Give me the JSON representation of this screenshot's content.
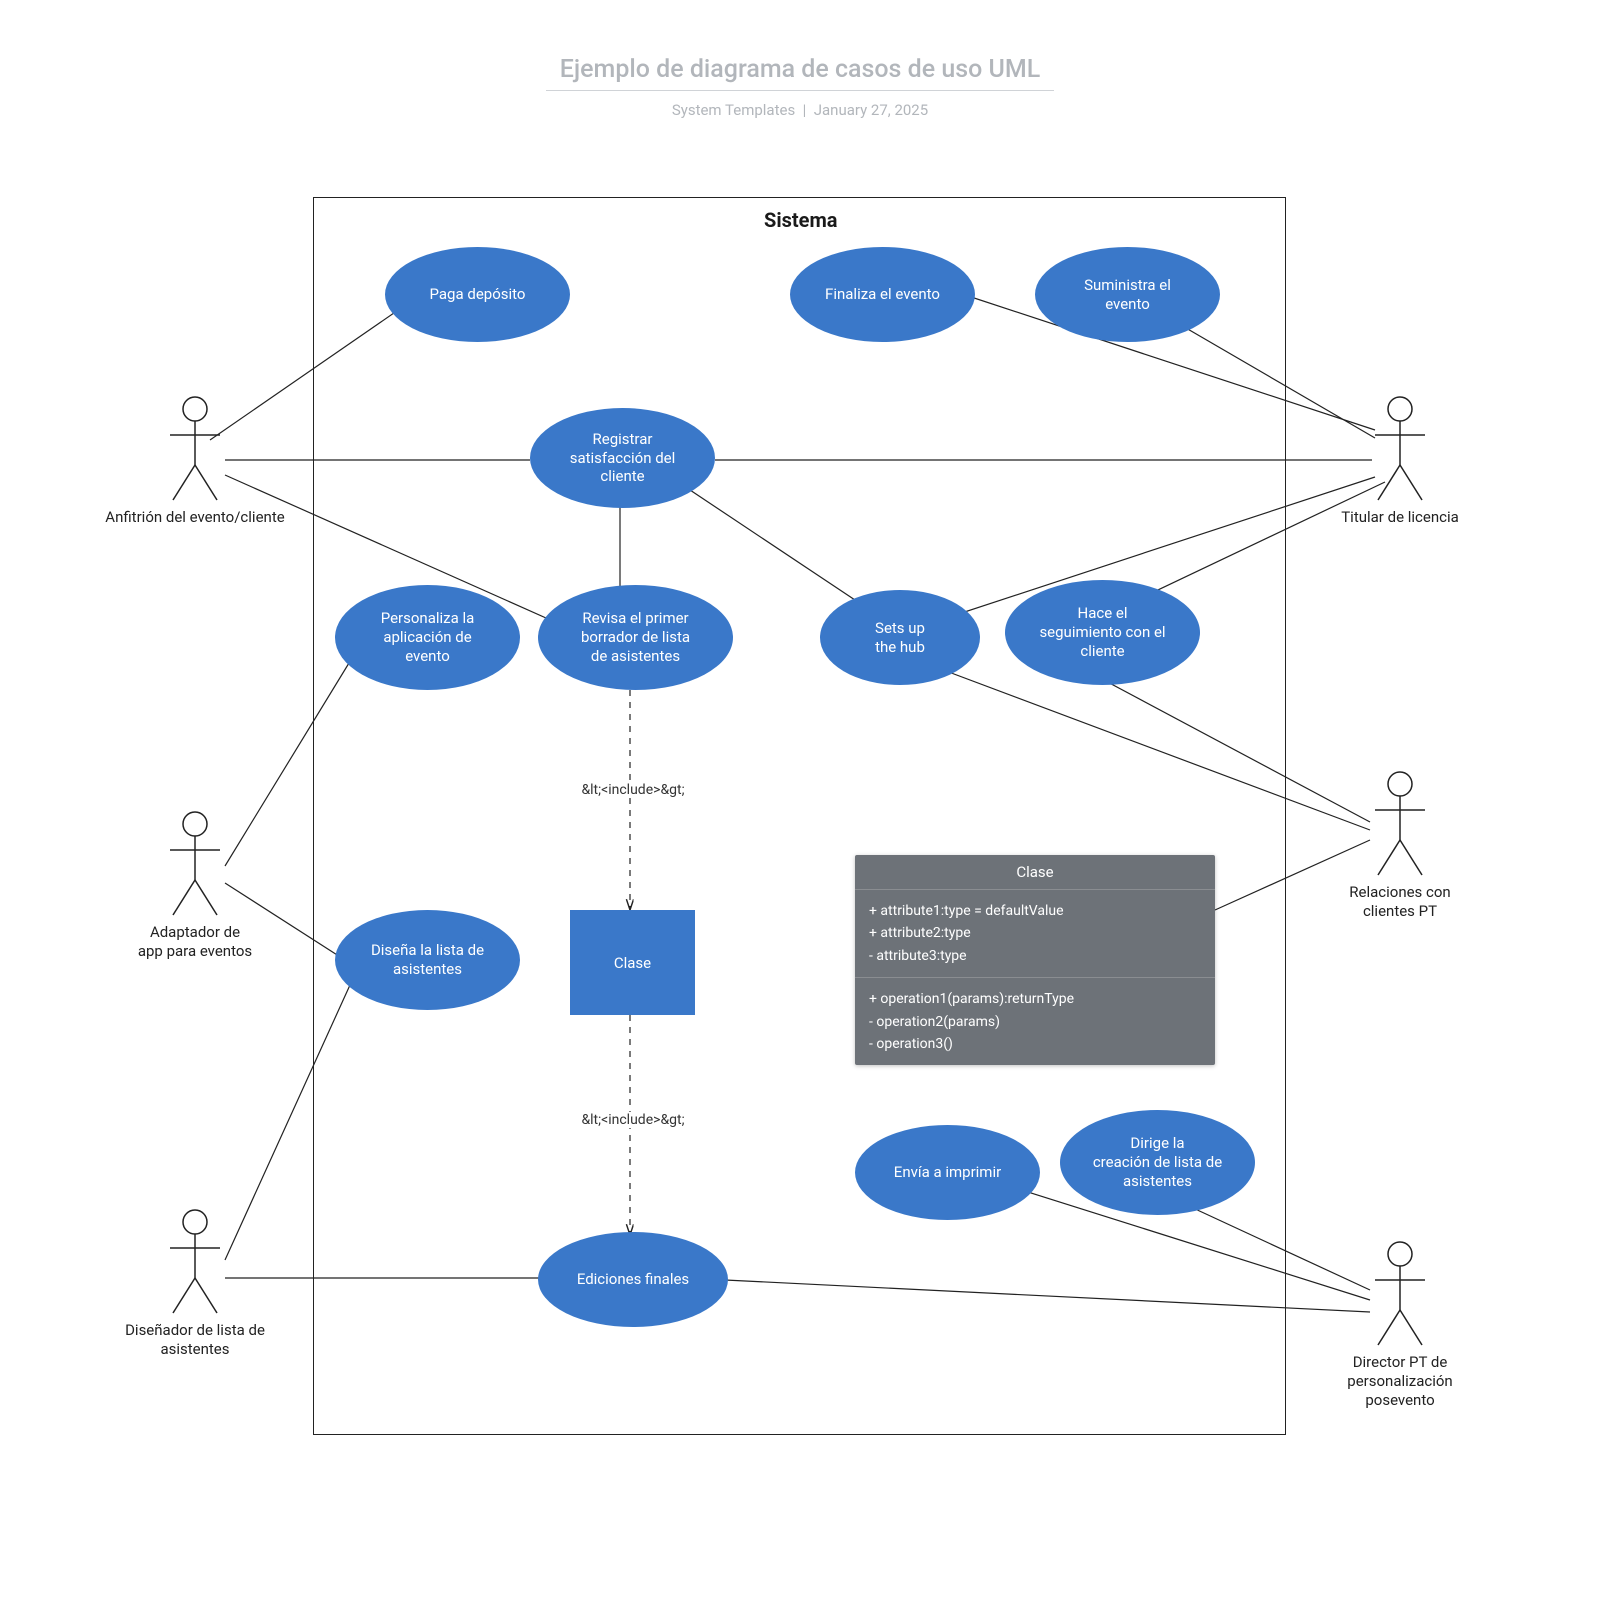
{
  "header": {
    "title": "Ejemplo de diagrama de casos de uso UML",
    "author": "System Templates",
    "date": "January 27, 2025"
  },
  "system": {
    "title": "Sistema"
  },
  "actors": {
    "host": {
      "label": "Anfitrión del evento/cliente"
    },
    "adapter": {
      "label": "Adaptador de\napp para eventos"
    },
    "designer": {
      "label": "Diseñador de lista de\nasistentes"
    },
    "licensee": {
      "label": "Titular de licencia"
    },
    "crm": {
      "label": "Relaciones con\nclientes PT"
    },
    "director": {
      "label": "Director PT de\npersonalización\nposevento"
    }
  },
  "usecases": {
    "pay": "Paga depósito",
    "finalize": "Finaliza el evento",
    "supply": "Suministra el\nevento",
    "register": "Registrar\nsatisfacción del\ncliente",
    "customize": "Personaliza la\naplicación de\nevento",
    "review": "Revisa el primer\nborrador de lista\nde asistentes",
    "setuphub": "Sets up\nthe hub",
    "follow": "Hace el\nseguimiento con el\ncliente",
    "design": "Diseña la lista de\nasistentes",
    "print": "Envía a imprimir",
    "manage": "Dirige la\ncreación de lista de\nasistentes",
    "final": "Ediciones finales"
  },
  "boxes": {
    "class_small": "Clase"
  },
  "classbox": {
    "title": "Clase",
    "attrs": [
      "+ attribute1:type = defaultValue",
      "+ attribute2:type",
      "- attribute3:type"
    ],
    "ops": [
      "+ operation1(params):returnType",
      "- operation2(params)",
      "- operation3()"
    ]
  },
  "include_label": "&lt;<include>&gt;"
}
